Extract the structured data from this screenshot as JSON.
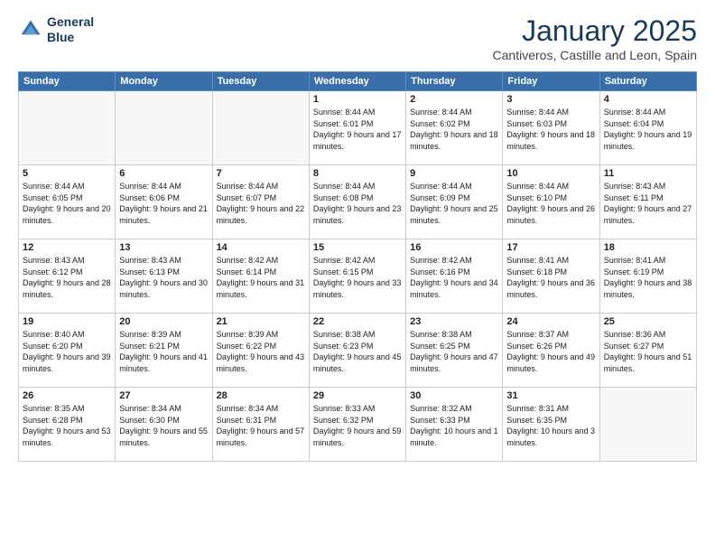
{
  "logo": {
    "line1": "General",
    "line2": "Blue"
  },
  "title": "January 2025",
  "location": "Cantiveros, Castille and Leon, Spain",
  "weekdays": [
    "Sunday",
    "Monday",
    "Tuesday",
    "Wednesday",
    "Thursday",
    "Friday",
    "Saturday"
  ],
  "weeks": [
    [
      {
        "day": "",
        "sunrise": "",
        "sunset": "",
        "daylight": ""
      },
      {
        "day": "",
        "sunrise": "",
        "sunset": "",
        "daylight": ""
      },
      {
        "day": "",
        "sunrise": "",
        "sunset": "",
        "daylight": ""
      },
      {
        "day": "1",
        "sunrise": "Sunrise: 8:44 AM",
        "sunset": "Sunset: 6:01 PM",
        "daylight": "Daylight: 9 hours and 17 minutes."
      },
      {
        "day": "2",
        "sunrise": "Sunrise: 8:44 AM",
        "sunset": "Sunset: 6:02 PM",
        "daylight": "Daylight: 9 hours and 18 minutes."
      },
      {
        "day": "3",
        "sunrise": "Sunrise: 8:44 AM",
        "sunset": "Sunset: 6:03 PM",
        "daylight": "Daylight: 9 hours and 18 minutes."
      },
      {
        "day": "4",
        "sunrise": "Sunrise: 8:44 AM",
        "sunset": "Sunset: 6:04 PM",
        "daylight": "Daylight: 9 hours and 19 minutes."
      }
    ],
    [
      {
        "day": "5",
        "sunrise": "Sunrise: 8:44 AM",
        "sunset": "Sunset: 6:05 PM",
        "daylight": "Daylight: 9 hours and 20 minutes."
      },
      {
        "day": "6",
        "sunrise": "Sunrise: 8:44 AM",
        "sunset": "Sunset: 6:06 PM",
        "daylight": "Daylight: 9 hours and 21 minutes."
      },
      {
        "day": "7",
        "sunrise": "Sunrise: 8:44 AM",
        "sunset": "Sunset: 6:07 PM",
        "daylight": "Daylight: 9 hours and 22 minutes."
      },
      {
        "day": "8",
        "sunrise": "Sunrise: 8:44 AM",
        "sunset": "Sunset: 6:08 PM",
        "daylight": "Daylight: 9 hours and 23 minutes."
      },
      {
        "day": "9",
        "sunrise": "Sunrise: 8:44 AM",
        "sunset": "Sunset: 6:09 PM",
        "daylight": "Daylight: 9 hours and 25 minutes."
      },
      {
        "day": "10",
        "sunrise": "Sunrise: 8:44 AM",
        "sunset": "Sunset: 6:10 PM",
        "daylight": "Daylight: 9 hours and 26 minutes."
      },
      {
        "day": "11",
        "sunrise": "Sunrise: 8:43 AM",
        "sunset": "Sunset: 6:11 PM",
        "daylight": "Daylight: 9 hours and 27 minutes."
      }
    ],
    [
      {
        "day": "12",
        "sunrise": "Sunrise: 8:43 AM",
        "sunset": "Sunset: 6:12 PM",
        "daylight": "Daylight: 9 hours and 28 minutes."
      },
      {
        "day": "13",
        "sunrise": "Sunrise: 8:43 AM",
        "sunset": "Sunset: 6:13 PM",
        "daylight": "Daylight: 9 hours and 30 minutes."
      },
      {
        "day": "14",
        "sunrise": "Sunrise: 8:42 AM",
        "sunset": "Sunset: 6:14 PM",
        "daylight": "Daylight: 9 hours and 31 minutes."
      },
      {
        "day": "15",
        "sunrise": "Sunrise: 8:42 AM",
        "sunset": "Sunset: 6:15 PM",
        "daylight": "Daylight: 9 hours and 33 minutes."
      },
      {
        "day": "16",
        "sunrise": "Sunrise: 8:42 AM",
        "sunset": "Sunset: 6:16 PM",
        "daylight": "Daylight: 9 hours and 34 minutes."
      },
      {
        "day": "17",
        "sunrise": "Sunrise: 8:41 AM",
        "sunset": "Sunset: 6:18 PM",
        "daylight": "Daylight: 9 hours and 36 minutes."
      },
      {
        "day": "18",
        "sunrise": "Sunrise: 8:41 AM",
        "sunset": "Sunset: 6:19 PM",
        "daylight": "Daylight: 9 hours and 38 minutes."
      }
    ],
    [
      {
        "day": "19",
        "sunrise": "Sunrise: 8:40 AM",
        "sunset": "Sunset: 6:20 PM",
        "daylight": "Daylight: 9 hours and 39 minutes."
      },
      {
        "day": "20",
        "sunrise": "Sunrise: 8:39 AM",
        "sunset": "Sunset: 6:21 PM",
        "daylight": "Daylight: 9 hours and 41 minutes."
      },
      {
        "day": "21",
        "sunrise": "Sunrise: 8:39 AM",
        "sunset": "Sunset: 6:22 PM",
        "daylight": "Daylight: 9 hours and 43 minutes."
      },
      {
        "day": "22",
        "sunrise": "Sunrise: 8:38 AM",
        "sunset": "Sunset: 6:23 PM",
        "daylight": "Daylight: 9 hours and 45 minutes."
      },
      {
        "day": "23",
        "sunrise": "Sunrise: 8:38 AM",
        "sunset": "Sunset: 6:25 PM",
        "daylight": "Daylight: 9 hours and 47 minutes."
      },
      {
        "day": "24",
        "sunrise": "Sunrise: 8:37 AM",
        "sunset": "Sunset: 6:26 PM",
        "daylight": "Daylight: 9 hours and 49 minutes."
      },
      {
        "day": "25",
        "sunrise": "Sunrise: 8:36 AM",
        "sunset": "Sunset: 6:27 PM",
        "daylight": "Daylight: 9 hours and 51 minutes."
      }
    ],
    [
      {
        "day": "26",
        "sunrise": "Sunrise: 8:35 AM",
        "sunset": "Sunset: 6:28 PM",
        "daylight": "Daylight: 9 hours and 53 minutes."
      },
      {
        "day": "27",
        "sunrise": "Sunrise: 8:34 AM",
        "sunset": "Sunset: 6:30 PM",
        "daylight": "Daylight: 9 hours and 55 minutes."
      },
      {
        "day": "28",
        "sunrise": "Sunrise: 8:34 AM",
        "sunset": "Sunset: 6:31 PM",
        "daylight": "Daylight: 9 hours and 57 minutes."
      },
      {
        "day": "29",
        "sunrise": "Sunrise: 8:33 AM",
        "sunset": "Sunset: 6:32 PM",
        "daylight": "Daylight: 9 hours and 59 minutes."
      },
      {
        "day": "30",
        "sunrise": "Sunrise: 8:32 AM",
        "sunset": "Sunset: 6:33 PM",
        "daylight": "Daylight: 10 hours and 1 minute."
      },
      {
        "day": "31",
        "sunrise": "Sunrise: 8:31 AM",
        "sunset": "Sunset: 6:35 PM",
        "daylight": "Daylight: 10 hours and 3 minutes."
      },
      {
        "day": "",
        "sunrise": "",
        "sunset": "",
        "daylight": ""
      }
    ]
  ]
}
